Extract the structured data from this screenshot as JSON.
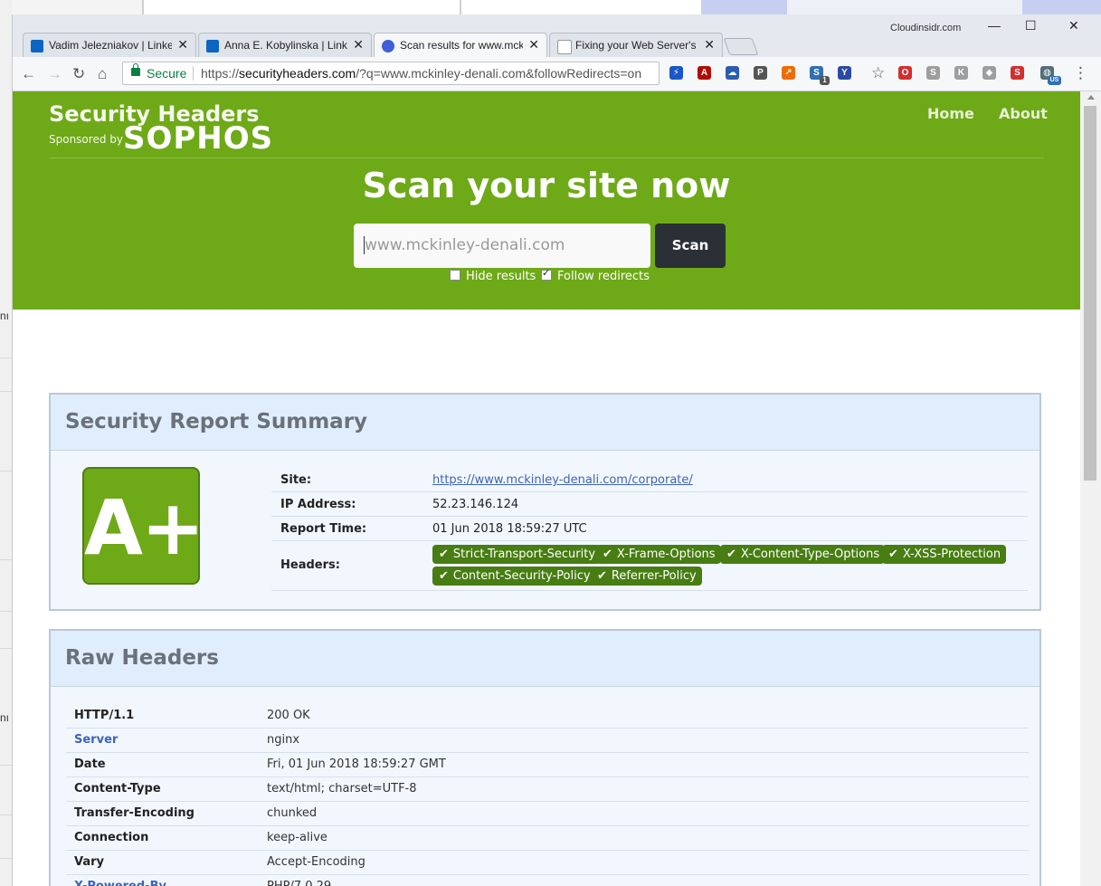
{
  "desktop": {
    "left_fragments": [
      "nı",
      "nı"
    ]
  },
  "window": {
    "brand_label": "Cloudinsidr.com",
    "controls": {
      "minimize": "—",
      "maximize": "☐",
      "close": "✕"
    }
  },
  "tabs": [
    {
      "title": "Vadim Jelezniakov | Linke",
      "favicon": "linkedin-icon",
      "close": "✕",
      "active": false
    },
    {
      "title": "Anna E. Kobylinska | Linke",
      "favicon": "linkedin-icon",
      "close": "✕",
      "active": false
    },
    {
      "title": "Scan results for www.mck",
      "favicon": "securityheaders-icon",
      "close": "✕",
      "active": true
    },
    {
      "title": "Fixing your Web Server's",
      "favicon": "cloudinsidr-icon",
      "close": "✕",
      "active": false
    }
  ],
  "toolbar": {
    "back": "←",
    "forward": "→",
    "reload": "↻",
    "home": "⌂",
    "secure_label": "Secure",
    "url_prefix": "https://",
    "url_host": "securityheaders.com",
    "url_rest": "/?q=www.mckinley-denali.com&followRedirects=on",
    "star": "☆",
    "menu": "⋮"
  },
  "extensions": [
    {
      "name": "bolt-icon",
      "glyph": "⚡",
      "color": "#1a56c9"
    },
    {
      "name": "acrobat-icon",
      "glyph": "A",
      "color": "#b30b00"
    },
    {
      "name": "cloud-icon",
      "glyph": "☁",
      "color": "#2a5db0"
    },
    {
      "name": "pocket-icon",
      "glyph": "P",
      "color": "#555555"
    },
    {
      "name": "chart-icon",
      "glyph": "↗",
      "color": "#ef6c00"
    },
    {
      "name": "s-badge-icon",
      "glyph": "S",
      "color": "#2f6fb4"
    },
    {
      "name": "y-icon",
      "glyph": "Y",
      "color": "#2b4aa8"
    },
    {
      "name": "opera-icon",
      "glyph": "O",
      "color": "#d32f2f"
    },
    {
      "name": "s-gray-icon",
      "glyph": "S",
      "color": "#9e9e9e"
    },
    {
      "name": "k-icon",
      "glyph": "K",
      "color": "#9e9e9e"
    },
    {
      "name": "shield-icon",
      "glyph": "◆",
      "color": "#9e9e9e"
    },
    {
      "name": "s-red-icon",
      "glyph": "S",
      "color": "#d32f2f"
    },
    {
      "name": "vpn-globe-icon",
      "glyph": "◍",
      "color": "#546e7a"
    }
  ],
  "extension_badges": {
    "s_badge": "1",
    "vpn": "US"
  },
  "site": {
    "title": "Security Headers",
    "sponsored_by": "Sponsored by",
    "sponsor": "SOPHOS",
    "nav": [
      "Home",
      "About"
    ],
    "heading": "Scan your site now",
    "search_value": "www.mckinley-denali.com",
    "scan_label": "Scan",
    "options": [
      {
        "label": "Hide results",
        "checked": false
      },
      {
        "label": "Follow redirects",
        "checked": true
      }
    ]
  },
  "summary": {
    "title": "Security Report Summary",
    "grade": "A+",
    "grade_color": "#6ea918",
    "rows": [
      {
        "key": "Site:",
        "value": "https://www.mckinley-denali.com/corporate/"
      },
      {
        "key": "IP Address:",
        "value": "52.23.146.124"
      },
      {
        "key": "Report Time:",
        "value": "01 Jun 2018 18:59:27 UTC"
      },
      {
        "key": "Headers:"
      }
    ],
    "headers": [
      "Strict-Transport-Security",
      "X-Frame-Options",
      "X-Content-Type-Options",
      "X-XSS-Protection",
      "Content-Security-Policy",
      "Referrer-Policy"
    ],
    "header_check": "✔",
    "pill_color": "#477d12"
  },
  "raw": {
    "title": "Raw Headers",
    "rows": [
      {
        "key": "HTTP/1.1",
        "value": "200 OK",
        "link": false
      },
      {
        "key": "Server",
        "value": "nginx",
        "link": true
      },
      {
        "key": "Date",
        "value": "Fri, 01 Jun 2018 18:59:27 GMT",
        "link": false
      },
      {
        "key": "Content-Type",
        "value": "text/html; charset=UTF-8",
        "link": false
      },
      {
        "key": "Transfer-Encoding",
        "value": "chunked",
        "link": false
      },
      {
        "key": "Connection",
        "value": "keep-alive",
        "link": false
      },
      {
        "key": "Vary",
        "value": "Accept-Encoding",
        "link": false
      },
      {
        "key": "X-Powered-By",
        "value": "PHP/7.0.29",
        "link": true
      }
    ]
  }
}
